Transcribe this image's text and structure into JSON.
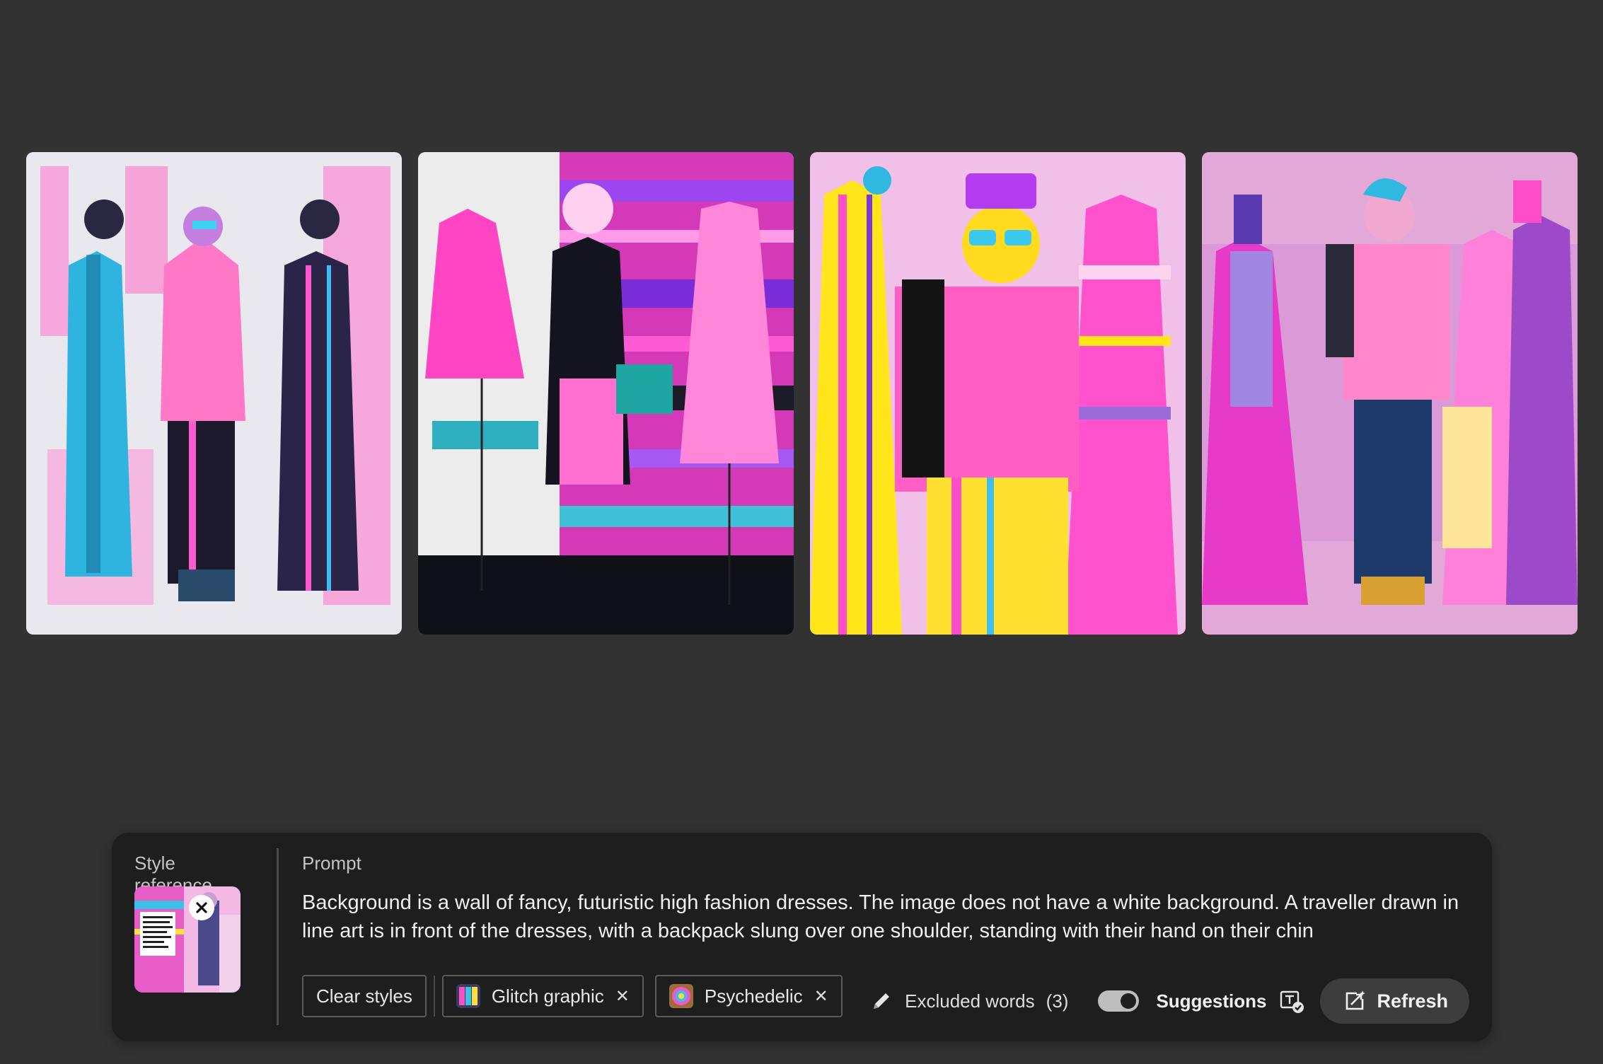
{
  "gallery": {
    "images": [
      {
        "name": "result-image-1"
      },
      {
        "name": "result-image-2"
      },
      {
        "name": "result-image-3"
      },
      {
        "name": "result-image-4"
      }
    ]
  },
  "panel": {
    "style_reference_label": "Style reference",
    "prompt_label": "Prompt",
    "prompt_text": "Background is a wall of fancy, futuristic high fashion dresses. The image does not have a white background. A traveller drawn in line art is in front of the dresses, with a backpack slung over one shoulder, standing with their hand on their chin",
    "chips": {
      "clear_styles": "Clear styles",
      "style1": "Glitch graphic",
      "style2": "Psychedelic",
      "remove_symbol": "✕"
    },
    "excluded_label": "Excluded words",
    "excluded_count": "(3)",
    "suggestions_label": "Suggestions",
    "suggestions_on": true,
    "refresh_label": "Refresh"
  },
  "colors": {
    "background": "#323232",
    "panel": "#1e1e1e",
    "magenta": "#ff3cc8",
    "cyan": "#2fb8e0",
    "yellow": "#ffe81a"
  }
}
